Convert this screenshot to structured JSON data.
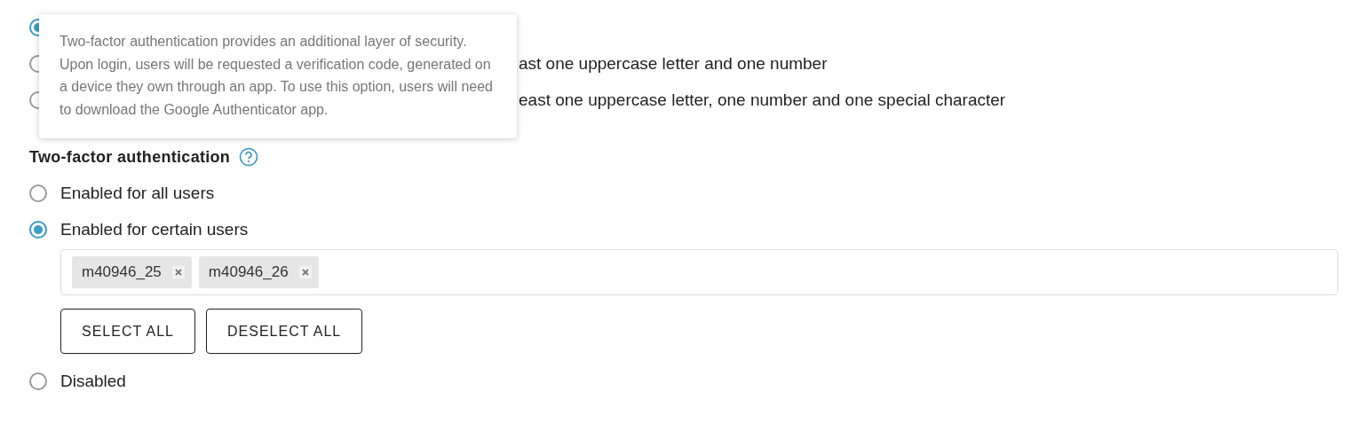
{
  "password_options": [
    {
      "selected": true
    },
    {
      "selected": false,
      "label": "ast one uppercase letter and one number"
    },
    {
      "selected": false,
      "label": "east one uppercase letter, one number and one special character"
    }
  ],
  "tooltip": {
    "text": "Two-factor authentication provides an additional layer of security. Upon login, users will be requested a verification code, generated on a device they own through an app. To use this option, users will need to download the Google Authenticator app."
  },
  "two_factor": {
    "title": "Two-factor authentication",
    "options": [
      {
        "label": "Enabled for all users",
        "selected": false,
        "kind": "plain"
      },
      {
        "label": "Enabled for certain users",
        "selected": true,
        "kind": "users"
      },
      {
        "label": "Disabled",
        "selected": false,
        "kind": "plain"
      }
    ],
    "users": [
      "m40946_25",
      "m40946_26"
    ],
    "buttons": [
      "SELECT ALL",
      "DESELECT ALL"
    ]
  }
}
